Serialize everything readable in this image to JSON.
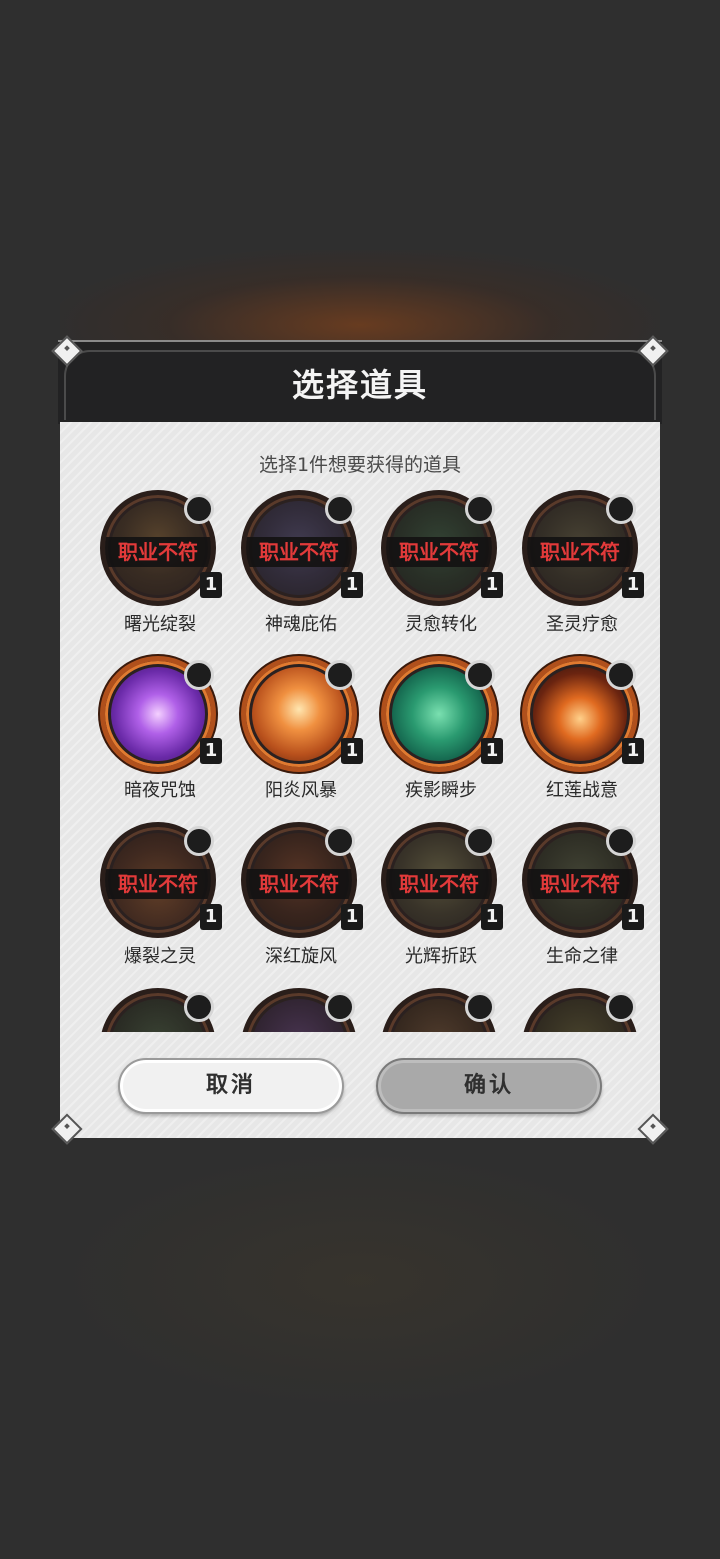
{
  "dialog": {
    "title": "选择道具",
    "subtitle": "选择1件想要获得的道具",
    "mismatch_label": "职业不符",
    "cancel_label": "取消",
    "confirm_label": "确认"
  },
  "items": [
    {
      "name": "曙光绽裂",
      "count": "1",
      "class_mismatch": true,
      "art": "sun-burst-icon"
    },
    {
      "name": "神魂庇佑",
      "count": "1",
      "class_mismatch": true,
      "art": "spirit-shield-icon"
    },
    {
      "name": "灵愈转化",
      "count": "1",
      "class_mismatch": true,
      "art": "heal-transform-icon"
    },
    {
      "name": "圣灵疗愈",
      "count": "1",
      "class_mismatch": true,
      "art": "holy-heal-icon"
    },
    {
      "name": "暗夜咒蚀",
      "count": "1",
      "class_mismatch": false,
      "art": "dark-star-icon"
    },
    {
      "name": "阳炎风暴",
      "count": "1",
      "class_mismatch": false,
      "art": "fire-storm-icon"
    },
    {
      "name": "疾影瞬步",
      "count": "1",
      "class_mismatch": false,
      "art": "shadow-step-icon"
    },
    {
      "name": "红莲战意",
      "count": "1",
      "class_mismatch": false,
      "art": "flame-spirit-icon"
    },
    {
      "name": "爆裂之灵",
      "count": "1",
      "class_mismatch": true,
      "art": "blast-spirit-icon"
    },
    {
      "name": "深红旋风",
      "count": "1",
      "class_mismatch": true,
      "art": "crimson-whirl-icon"
    },
    {
      "name": "光辉折跃",
      "count": "1",
      "class_mismatch": true,
      "art": "radiant-leap-icon"
    },
    {
      "name": "生命之律",
      "count": "1",
      "class_mismatch": true,
      "art": "life-law-icon"
    }
  ],
  "colors": {
    "mismatch_text": "#e23a3a",
    "header_bg": "#222223",
    "panel_bg": "#e7e7e7"
  }
}
